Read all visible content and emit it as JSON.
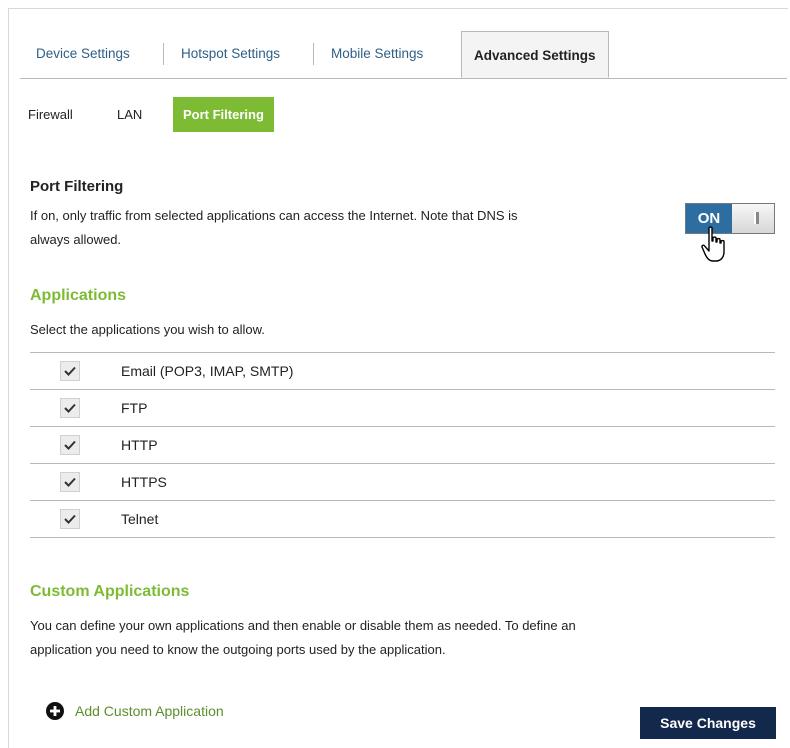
{
  "tabs": {
    "device": "Device Settings",
    "hotspot": "Hotspot Settings",
    "mobile": "Mobile Settings",
    "advanced": "Advanced Settings"
  },
  "subtabs": {
    "firewall": "Firewall",
    "lan": "LAN",
    "port_filtering": "Port Filtering"
  },
  "port_filtering": {
    "heading": "Port Filtering",
    "description_line1": "If on, only traffic from selected applications can access the Internet. Note that DNS is",
    "description_line2": "always allowed.",
    "toggle_label": "ON",
    "toggle_state": true
  },
  "applications": {
    "heading": "Applications",
    "instruction": "Select the applications you wish to allow.",
    "items": [
      {
        "label": "Email (POP3, IMAP, SMTP)",
        "checked": true
      },
      {
        "label": "FTP",
        "checked": true
      },
      {
        "label": "HTTP",
        "checked": true
      },
      {
        "label": "HTTPS",
        "checked": true
      },
      {
        "label": "Telnet",
        "checked": true
      }
    ]
  },
  "custom_applications": {
    "heading": "Custom Applications",
    "description_line1": "You can define your own applications and then enable or disable them as needed. To define an",
    "description_line2": "application you need to know the outgoing ports used by the application.",
    "add_label": "Add Custom Application"
  },
  "actions": {
    "save_label": "Save Changes"
  },
  "colors": {
    "accent_green": "#7dbb35",
    "toggle_blue": "#2d6da0",
    "button_navy": "#13294b",
    "tab_link": "#2f5f86"
  }
}
